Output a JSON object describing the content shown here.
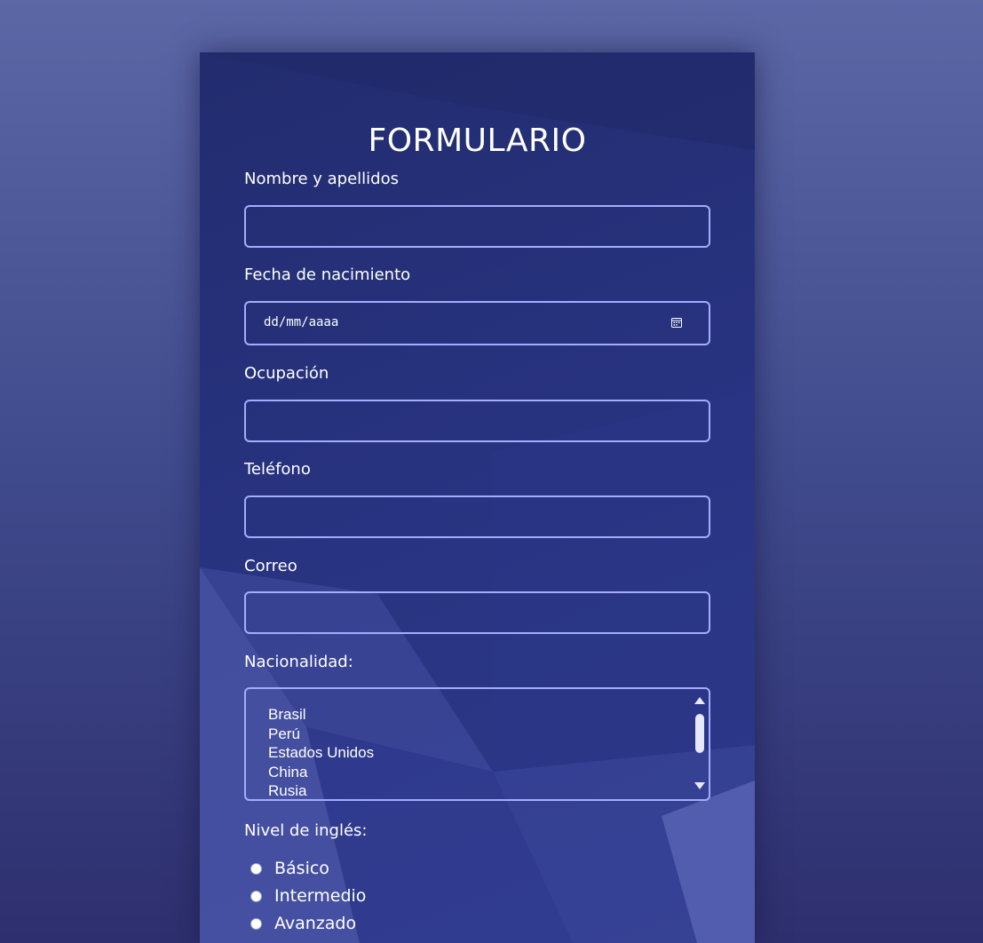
{
  "form": {
    "title": "FORMULARIO",
    "fields": {
      "name_label": "Nombre y apellidos",
      "name_value": "",
      "birthdate_label": "Fecha de nacimiento",
      "birthdate_placeholder": "dd/mm/aaaa",
      "occupation_label": "Ocupación",
      "occupation_value": "",
      "phone_label": "Teléfono",
      "phone_value": "",
      "email_label": "Correo",
      "email_value": "",
      "nationality_label": "Nacionalidad:",
      "nationality_options": [
        "Brasil",
        "Perú",
        "Estados Unidos",
        "China",
        "Rusia"
      ],
      "english_label": "Nivel de inglés:",
      "english_options": [
        "Básico",
        "Intermedio",
        "Avanzado"
      ]
    }
  },
  "icons": {
    "calendar": "calendar-icon",
    "scroll_up": "triangle-up-icon",
    "scroll_down": "triangle-down-icon"
  },
  "colors": {
    "background": "#4a5596",
    "card": "#27327a",
    "input_border": "#a5acff",
    "text": "#ffffff"
  }
}
